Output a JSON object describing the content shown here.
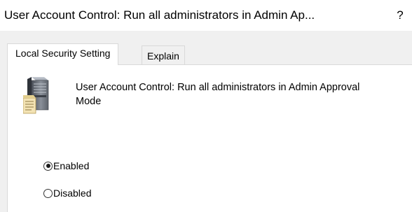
{
  "window": {
    "title": "User Account Control: Run all administrators in Admin Ap...",
    "help_label": "?"
  },
  "tabs": [
    {
      "label": "Local Security Setting",
      "active": true
    },
    {
      "label": "Explain",
      "active": false
    }
  ],
  "policy": {
    "icon": "server-policy-icon",
    "name_line1": "User Account Control: Run all administrators in Admin Approval",
    "name_line2": "Mode"
  },
  "options": [
    {
      "label": "Enabled",
      "selected": true
    },
    {
      "label": "Disabled",
      "selected": false
    }
  ]
}
